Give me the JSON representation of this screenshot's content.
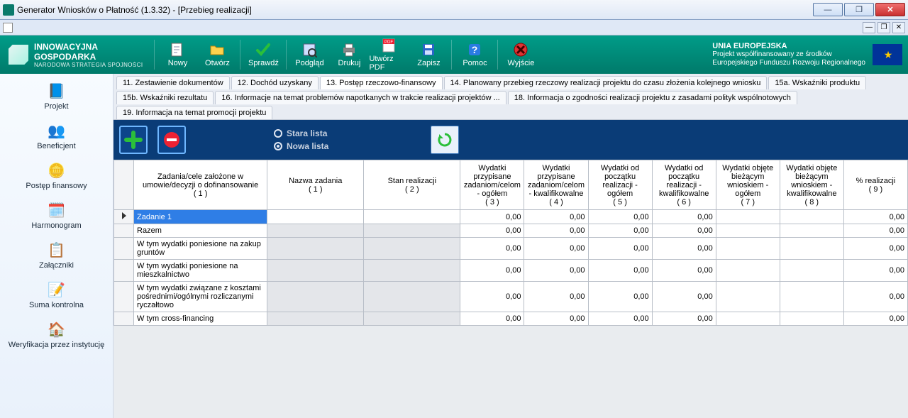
{
  "window": {
    "title": "Generator Wniosków o Płatność (1.3.32) - [Przebieg realizacji]"
  },
  "logo": {
    "line1": "INNOWACYJNA",
    "line2": "GOSPODARKA",
    "line3": "NARODOWA STRATEGIA SPÓJNOŚCI"
  },
  "toolbar": {
    "nowy": "Nowy",
    "otworz": "Otwórz",
    "sprawdz": "Sprawdź",
    "podglad": "Podgląd",
    "drukuj": "Drukuj",
    "utworz_pdf": "Utwórz PDF",
    "zapisz": "Zapisz",
    "pomoc": "Pomoc",
    "wyjscie": "Wyjście"
  },
  "eu": {
    "title": "UNIA EUROPEJSKA",
    "line1": "Projekt współfinansowany ze środków",
    "line2": "Europejskiego Funduszu Rozwoju Regionalnego"
  },
  "nav": {
    "projekt": "Projekt",
    "beneficjent": "Beneficjent",
    "postep": "Postęp finansowy",
    "harmonogram": "Harmonogram",
    "zalaczniki": "Załączniki",
    "suma": "Suma kontrolna",
    "weryfikacja": "Weryfikacja przez instytucję"
  },
  "tabs": {
    "t11": "11. Zestawienie dokumentów",
    "t12": "12. Dochód uzyskany",
    "t13": "13. Postęp rzeczowo-finansowy",
    "t14": "14. Planowany przebieg rzeczowy realizacji projektu do czasu złożenia kolejnego wniosku",
    "t15a": "15a. Wskaźniki produktu",
    "t15b": "15b. Wskaźniki rezultatu",
    "t16": "16. Informacje na temat problemów napotkanych w trakcie realizacji projektów ...",
    "t18": "18. Informacja o zgodności realizacji projektu z zasadami polityk wspólnotowych",
    "t19": "19. Informacja na temat promocji projektu"
  },
  "toolstrip": {
    "stara": "Stara lista",
    "nowa": "Nowa lista"
  },
  "grid": {
    "headers": {
      "zadania": "Zadania/cele założone w umowie/decyzji o dofinansowanie\n( 1 )",
      "nazwa": "Nazwa zadania\n( 1 )",
      "stan": "Stan realizacji\n( 2 )",
      "c3": "Wydatki przypisane zadaniom/celom - ogółem\n( 3 )",
      "c4": "Wydatki przypisane zadaniom/celom - kwalifikowalne\n( 4 )",
      "c5": "Wydatki od początku realizacji - ogółem\n( 5 )",
      "c6": "Wydatki od początku realizacji - kwalifikowalne\n( 6 )",
      "c7": "Wydatki objęte bieżącym wnioskiem - ogółem\n( 7 )",
      "c8": "Wydatki objęte bieżącym wnioskiem - kwalifikowalne\n( 8 )",
      "c9": "% realizacji\n( 9 )"
    },
    "rows": [
      {
        "label": "Zadanie 1",
        "selected": true,
        "gray_nazwa": false,
        "gray_stan": false,
        "v3": "0,00",
        "v4": "0,00",
        "v5": "0,00",
        "v6": "0,00",
        "v7": "",
        "v8": "",
        "v9": "0,00"
      },
      {
        "label": "Razem",
        "gray_nazwa": true,
        "gray_stan": true,
        "v3": "0,00",
        "v4": "0,00",
        "v5": "0,00",
        "v6": "0,00",
        "v7": "",
        "v8": "",
        "v9": "0,00"
      },
      {
        "label": "W tym wydatki poniesione na zakup gruntów",
        "gray_nazwa": true,
        "gray_stan": true,
        "v3": "0,00",
        "v4": "0,00",
        "v5": "0,00",
        "v6": "0,00",
        "v7": "",
        "v8": "",
        "v9": "0,00"
      },
      {
        "label": "W tym wydatki poniesione na mieszkalnictwo",
        "gray_nazwa": true,
        "gray_stan": true,
        "v3": "0,00",
        "v4": "0,00",
        "v5": "0,00",
        "v6": "0,00",
        "v7": "",
        "v8": "",
        "v9": "0,00"
      },
      {
        "label": "W tym wydatki związane z kosztami pośrednimi/ogólnymi rozliczanymi ryczałtowo",
        "gray_nazwa": true,
        "gray_stan": true,
        "v3": "0,00",
        "v4": "0,00",
        "v5": "0,00",
        "v6": "0,00",
        "v7": "",
        "v8": "",
        "v9": "0,00"
      },
      {
        "label": "W tym cross-financing",
        "gray_nazwa": true,
        "gray_stan": true,
        "v3": "0,00",
        "v4": "0,00",
        "v5": "0,00",
        "v6": "0,00",
        "v7": "",
        "v8": "",
        "v9": "0,00"
      }
    ]
  }
}
